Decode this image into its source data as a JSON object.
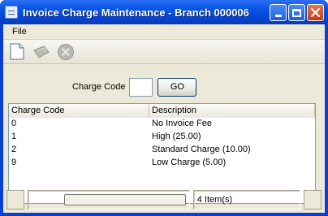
{
  "window": {
    "title": "Invoice Charge Maintenance - Branch 000006"
  },
  "menu": {
    "items": [
      "File"
    ]
  },
  "toolbar": {
    "icons": [
      "new-document-icon",
      "edit-icon",
      "delete-icon"
    ]
  },
  "search": {
    "label": "Charge Code",
    "value": "",
    "go_label": "GO"
  },
  "list": {
    "columns": [
      "Charge Code",
      "Description"
    ],
    "rows": [
      {
        "code": "0",
        "description": "No Invoice Fee"
      },
      {
        "code": "1",
        "description": "High (25.00)"
      },
      {
        "code": "2",
        "description": "Standard Charge (10.00)"
      },
      {
        "code": "9",
        "description": "Low Charge (5.00)"
      }
    ]
  },
  "status": {
    "count_text": "4 Item(s)",
    "progress": 0
  },
  "colors": {
    "titlebar": "#0a58e8",
    "close_button": "#c43b12",
    "client_bg": "#ece9d8"
  }
}
